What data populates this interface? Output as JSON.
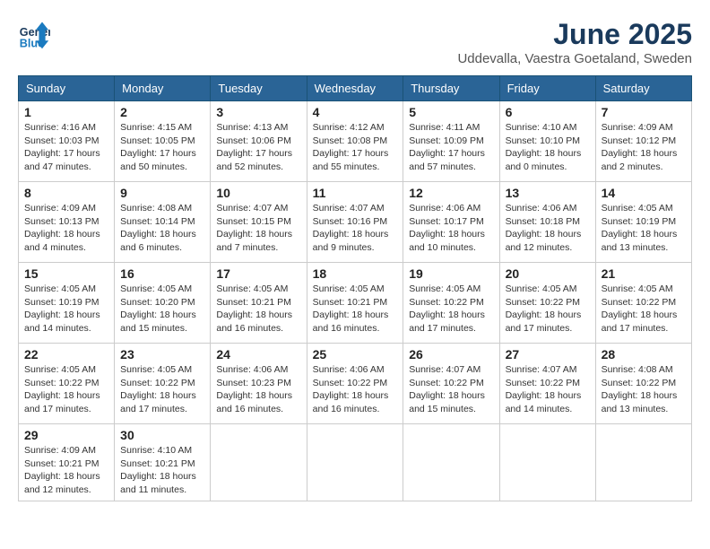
{
  "header": {
    "logo_line1": "General",
    "logo_line2": "Blue",
    "month": "June 2025",
    "location": "Uddevalla, Vaestra Goetaland, Sweden"
  },
  "weekdays": [
    "Sunday",
    "Monday",
    "Tuesday",
    "Wednesday",
    "Thursday",
    "Friday",
    "Saturday"
  ],
  "weeks": [
    [
      {
        "day": "1",
        "info": "Sunrise: 4:16 AM\nSunset: 10:03 PM\nDaylight: 17 hours\nand 47 minutes."
      },
      {
        "day": "2",
        "info": "Sunrise: 4:15 AM\nSunset: 10:05 PM\nDaylight: 17 hours\nand 50 minutes."
      },
      {
        "day": "3",
        "info": "Sunrise: 4:13 AM\nSunset: 10:06 PM\nDaylight: 17 hours\nand 52 minutes."
      },
      {
        "day": "4",
        "info": "Sunrise: 4:12 AM\nSunset: 10:08 PM\nDaylight: 17 hours\nand 55 minutes."
      },
      {
        "day": "5",
        "info": "Sunrise: 4:11 AM\nSunset: 10:09 PM\nDaylight: 17 hours\nand 57 minutes."
      },
      {
        "day": "6",
        "info": "Sunrise: 4:10 AM\nSunset: 10:10 PM\nDaylight: 18 hours\nand 0 minutes."
      },
      {
        "day": "7",
        "info": "Sunrise: 4:09 AM\nSunset: 10:12 PM\nDaylight: 18 hours\nand 2 minutes."
      }
    ],
    [
      {
        "day": "8",
        "info": "Sunrise: 4:09 AM\nSunset: 10:13 PM\nDaylight: 18 hours\nand 4 minutes."
      },
      {
        "day": "9",
        "info": "Sunrise: 4:08 AM\nSunset: 10:14 PM\nDaylight: 18 hours\nand 6 minutes."
      },
      {
        "day": "10",
        "info": "Sunrise: 4:07 AM\nSunset: 10:15 PM\nDaylight: 18 hours\nand 7 minutes."
      },
      {
        "day": "11",
        "info": "Sunrise: 4:07 AM\nSunset: 10:16 PM\nDaylight: 18 hours\nand 9 minutes."
      },
      {
        "day": "12",
        "info": "Sunrise: 4:06 AM\nSunset: 10:17 PM\nDaylight: 18 hours\nand 10 minutes."
      },
      {
        "day": "13",
        "info": "Sunrise: 4:06 AM\nSunset: 10:18 PM\nDaylight: 18 hours\nand 12 minutes."
      },
      {
        "day": "14",
        "info": "Sunrise: 4:05 AM\nSunset: 10:19 PM\nDaylight: 18 hours\nand 13 minutes."
      }
    ],
    [
      {
        "day": "15",
        "info": "Sunrise: 4:05 AM\nSunset: 10:19 PM\nDaylight: 18 hours\nand 14 minutes."
      },
      {
        "day": "16",
        "info": "Sunrise: 4:05 AM\nSunset: 10:20 PM\nDaylight: 18 hours\nand 15 minutes."
      },
      {
        "day": "17",
        "info": "Sunrise: 4:05 AM\nSunset: 10:21 PM\nDaylight: 18 hours\nand 16 minutes."
      },
      {
        "day": "18",
        "info": "Sunrise: 4:05 AM\nSunset: 10:21 PM\nDaylight: 18 hours\nand 16 minutes."
      },
      {
        "day": "19",
        "info": "Sunrise: 4:05 AM\nSunset: 10:22 PM\nDaylight: 18 hours\nand 17 minutes."
      },
      {
        "day": "20",
        "info": "Sunrise: 4:05 AM\nSunset: 10:22 PM\nDaylight: 18 hours\nand 17 minutes."
      },
      {
        "day": "21",
        "info": "Sunrise: 4:05 AM\nSunset: 10:22 PM\nDaylight: 18 hours\nand 17 minutes."
      }
    ],
    [
      {
        "day": "22",
        "info": "Sunrise: 4:05 AM\nSunset: 10:22 PM\nDaylight: 18 hours\nand 17 minutes."
      },
      {
        "day": "23",
        "info": "Sunrise: 4:05 AM\nSunset: 10:22 PM\nDaylight: 18 hours\nand 17 minutes."
      },
      {
        "day": "24",
        "info": "Sunrise: 4:06 AM\nSunset: 10:23 PM\nDaylight: 18 hours\nand 16 minutes."
      },
      {
        "day": "25",
        "info": "Sunrise: 4:06 AM\nSunset: 10:22 PM\nDaylight: 18 hours\nand 16 minutes."
      },
      {
        "day": "26",
        "info": "Sunrise: 4:07 AM\nSunset: 10:22 PM\nDaylight: 18 hours\nand 15 minutes."
      },
      {
        "day": "27",
        "info": "Sunrise: 4:07 AM\nSunset: 10:22 PM\nDaylight: 18 hours\nand 14 minutes."
      },
      {
        "day": "28",
        "info": "Sunrise: 4:08 AM\nSunset: 10:22 PM\nDaylight: 18 hours\nand 13 minutes."
      }
    ],
    [
      {
        "day": "29",
        "info": "Sunrise: 4:09 AM\nSunset: 10:21 PM\nDaylight: 18 hours\nand 12 minutes."
      },
      {
        "day": "30",
        "info": "Sunrise: 4:10 AM\nSunset: 10:21 PM\nDaylight: 18 hours\nand 11 minutes."
      },
      null,
      null,
      null,
      null,
      null
    ]
  ]
}
